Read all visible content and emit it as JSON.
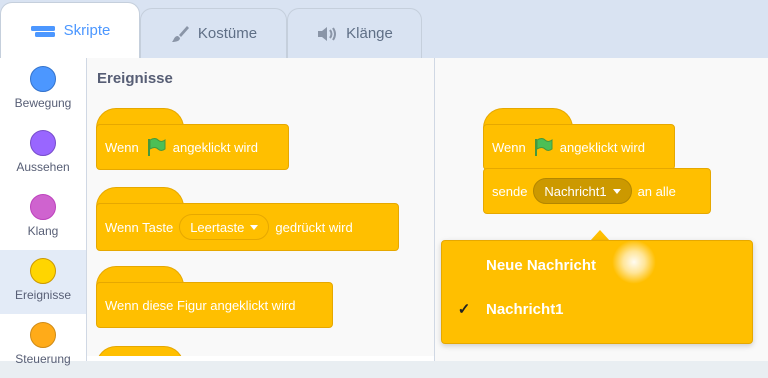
{
  "tabs": [
    {
      "label": "Skripte",
      "icon": "code-icon",
      "active": true
    },
    {
      "label": "Kostüme",
      "icon": "brush-icon",
      "active": false
    },
    {
      "label": "Klänge",
      "icon": "speaker-icon",
      "active": false
    }
  ],
  "categories": [
    {
      "label": "Bewegung",
      "color": "#4c97ff",
      "selected": false
    },
    {
      "label": "Aussehen",
      "color": "#9966ff",
      "selected": false
    },
    {
      "label": "Klang",
      "color": "#cf63cf",
      "selected": false
    },
    {
      "label": "Ereignisse",
      "color": "#ffd500",
      "selected": true
    },
    {
      "label": "Steuerung",
      "color": "#ffab19",
      "selected": false
    }
  ],
  "palette": {
    "title": "Ereignisse",
    "blocks": {
      "flag_clicked": {
        "pre": "Wenn",
        "post": "angeklickt wird"
      },
      "key_pressed": {
        "pre": "Wenn Taste",
        "key": "Leertaste",
        "post": "gedrückt wird"
      },
      "sprite_clicked": {
        "text": "Wenn diese Figur angeklickt wird"
      }
    }
  },
  "workspace": {
    "hat": {
      "pre": "Wenn",
      "post": "angeklickt wird"
    },
    "broadcast": {
      "pre": "sende",
      "message": "Nachricht1",
      "post": "an alle"
    }
  },
  "menu": {
    "items": [
      {
        "label": "Neue Nachricht",
        "checked": false
      },
      {
        "label": "Nachricht1",
        "checked": true
      }
    ],
    "check_symbol": "✓"
  },
  "colors": {
    "events": "#ffbf00",
    "events_border": "#e6a800",
    "accent": "#4c97ff",
    "flag": "#4cbf56"
  }
}
